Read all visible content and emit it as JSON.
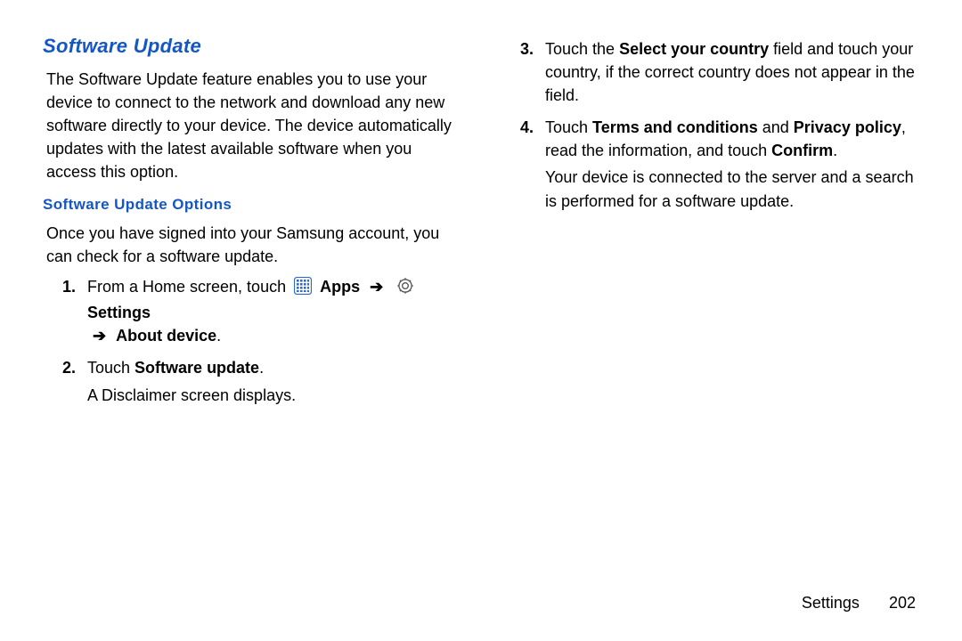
{
  "left": {
    "heading": "Software Update",
    "intro": "The Software Update feature enables you to use your device to connect to the network and download any new software directly to your device. The device automatically updates with the latest available software when you access this option.",
    "subheading": "Software Update Options",
    "sub_intro": "Once you have signed into your Samsung account, you can check for a software update.",
    "step1_lead": "From a Home screen, touch",
    "step1_apps": "Apps",
    "step1_settings": "Settings",
    "step1_tail": "About device",
    "step1_period": ".",
    "step2_lead": "Touch ",
    "step2_bold": "Software update",
    "step2_period": ".",
    "step2_sub": "A Disclaimer screen displays.",
    "arrow": "➔"
  },
  "right": {
    "step3_lead": "Touch the ",
    "step3_bold1": "Select your country",
    "step3_tail": " field and touch your country, if the correct country does not appear in the field.",
    "step4_lead": "Touch ",
    "step4_bold1": "Terms and conditions",
    "step4_mid1": " and ",
    "step4_bold2": "Privacy policy",
    "step4_mid2": ", read the information, and touch ",
    "step4_bold3": "Confirm",
    "step4_period": ".",
    "step4_sub": "Your device is connected to the server and a search is performed for a software update."
  },
  "footer": {
    "section": "Settings",
    "page": "202"
  }
}
